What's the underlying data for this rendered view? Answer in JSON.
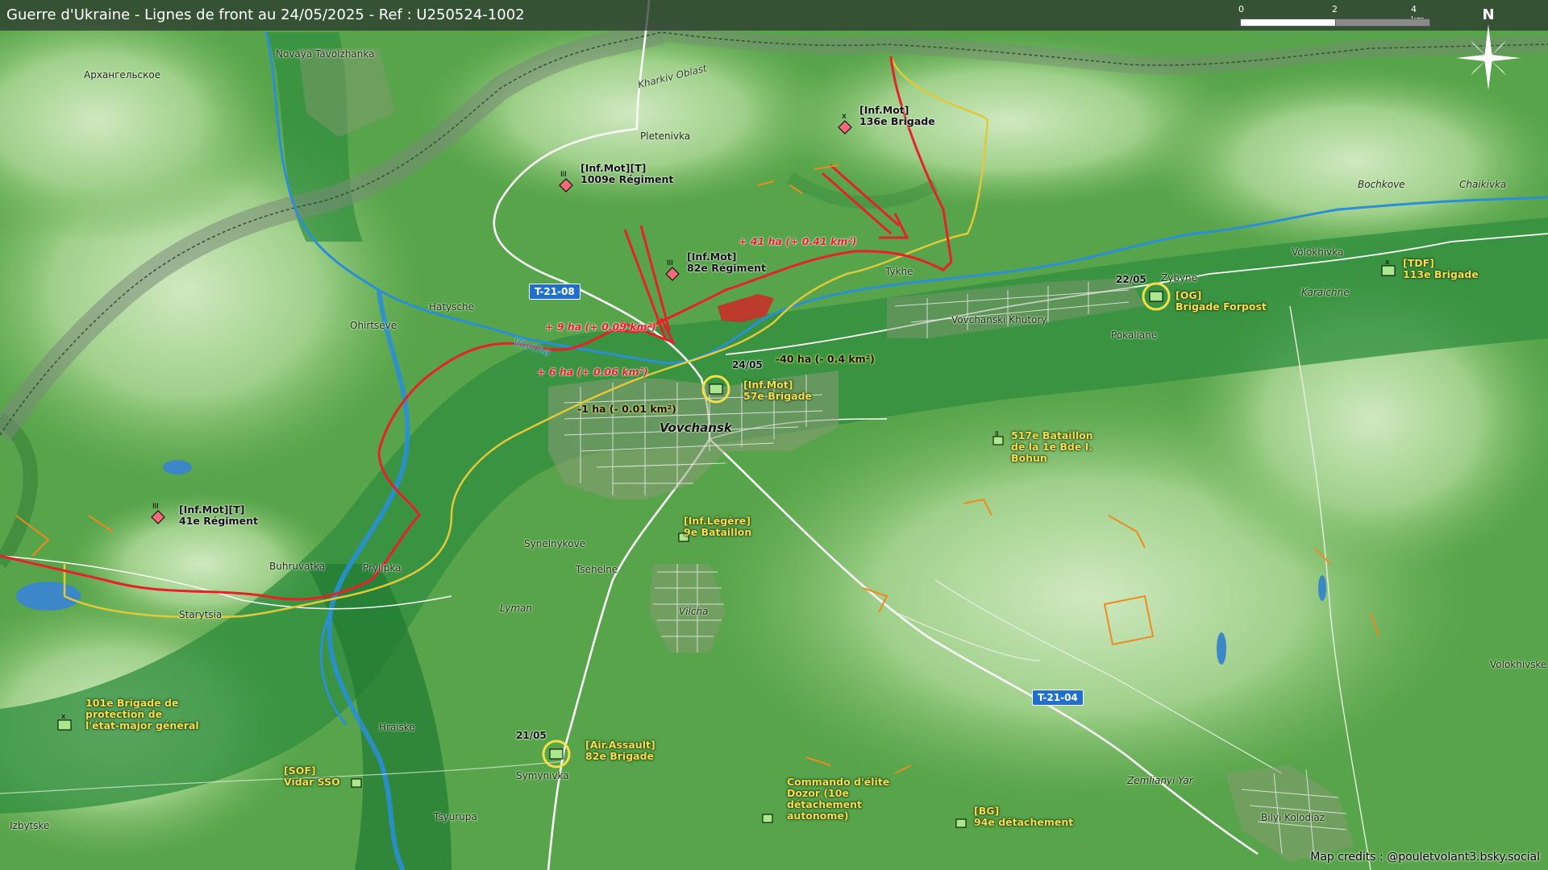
{
  "title": "Guerre d'Ukraine - Lignes de front au 24/05/2025 - Ref : U250524-1002",
  "scale": {
    "ticks": [
      "0",
      "2",
      "4 km"
    ]
  },
  "north_label": "N",
  "north_icon": "compass-rose-icon",
  "credits": "Map credits : @pouletvolant3.bsky.social",
  "colors": {
    "russian_front": "#e8202a",
    "ukrainian_line": "#e2c93a",
    "russian_unit": "#f06a78",
    "ukrainian_unit": "#a9e88d",
    "river": "#2a8fd6",
    "road_badge": "#1f6fcf"
  },
  "places": {
    "novaya_tavolzhanka": "Novaya Tavolzhanka",
    "arkhangelskoe": "Архангельское",
    "pletenivka": "Pletenivka",
    "kharkiv_oblast": "Kharkiv Oblast",
    "hatysche": "Hatysche",
    "ohirtseve": "Ohirtseve",
    "vovcha": "Vovcha",
    "tykhe": "Tykhe",
    "vovchanski_khutory": "Vovchanski Khutory",
    "vovchansk": "Vovchansk",
    "zybyne": "Zybyne",
    "pokaliane": "Pokaliane",
    "volokhivka": "Volokhivka",
    "karaichne": "Karaichne",
    "bochkove": "Bochkove",
    "chaikivka": "Chaikivka",
    "synelnykove": "Synelnykove",
    "tsehelne": "Tsehelne",
    "lyman": "Lyman",
    "vilcha": "Vilcha",
    "buhruvatka": "Buhruvatka",
    "prylipka": "Prylipka",
    "starytsia": "Starytsia",
    "hraiske": "Hraiske",
    "symynivka": "Symynivka",
    "tsyurupa": "Tsyurupa",
    "izbytske": "Izbytske",
    "zemlianyi_yar": "Zemlianyi Yar",
    "bilyi_kolodiaz": "Bilyi Kolodiaz",
    "volokhivske": "Volokhivske"
  },
  "roads": {
    "t2108": "T-21-08",
    "t2104": "T-21-04"
  },
  "russian_units": [
    {
      "id": "ru-136",
      "line1": "[Inf.Mot]",
      "line2": "136e Brigade",
      "echelon": "x"
    },
    {
      "id": "ru-1009",
      "line1": "[Inf.Mot][T]",
      "line2": "1009e Régiment",
      "echelon": "III"
    },
    {
      "id": "ru-82",
      "line1": "[Inf.Mot]",
      "line2": "82e Régiment",
      "echelon": "III"
    },
    {
      "id": "ru-41",
      "line1": "[Inf.Mot][T]",
      "line2": "41e Régiment",
      "echelon": "III"
    }
  ],
  "ukrainian_units": [
    {
      "id": "ua-57",
      "line1": "[Inf.Mot]",
      "line2": "57e Brigade",
      "line3": ""
    },
    {
      "id": "ua-og",
      "line1": "[OG]",
      "line2": "Brigade Forpost",
      "line3": ""
    },
    {
      "id": "ua-113",
      "line1": "[TDF]",
      "line2": "113e Brigade",
      "line3": ""
    },
    {
      "id": "ua-517",
      "line1": "517e Bataillon",
      "line2": "de la 1e Bde I.",
      "line3": "Bohun"
    },
    {
      "id": "ua-9",
      "line1": "[Inf.Légère]",
      "line2": "9e Bataillon",
      "line3": ""
    },
    {
      "id": "ua-101",
      "line1": "101e Brigade de",
      "line2": "protection de",
      "line3": "l'état-major général"
    },
    {
      "id": "ua-82aa",
      "line1": "[Air.Assault]",
      "line2": "82e Brigade",
      "line3": ""
    },
    {
      "id": "ua-sso",
      "line1": "[SOF]",
      "line2": "Vidar SSO",
      "line3": ""
    },
    {
      "id": "ua-dozor",
      "line1": "Commando d'élite",
      "line2": "Dozor (10e",
      "line3": "détachement",
      "line4": "autonome)"
    },
    {
      "id": "ua-94",
      "line1": "[BG]",
      "line2": "94e détachement",
      "line3": ""
    }
  ],
  "changes": {
    "gain_41": "+ 41 ha (+ 0.41 km²)",
    "gain_9": "+ 9 ha (+ 0.09 km²)",
    "gain_6": "+ 6 ha (+ 0.06 km²)",
    "loss_40": "-40 ha (- 0.4 km²)",
    "loss_1": "-1 ha (- 0.01 km²)"
  },
  "dates": {
    "d2405": "24/05",
    "d2205": "22/05",
    "d2105": "21/05"
  }
}
